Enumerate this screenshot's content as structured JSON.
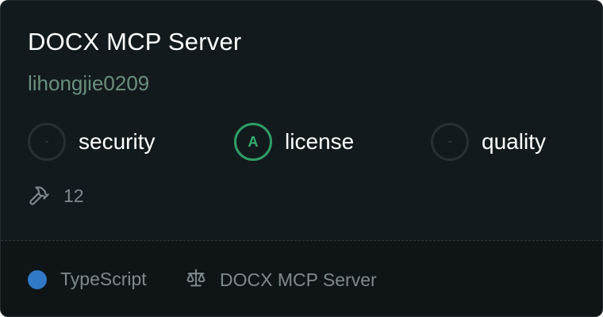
{
  "server": {
    "name": "DOCX MCP Server",
    "owner": "lihongjie0209"
  },
  "scores": [
    {
      "badge": "-",
      "label": "security"
    },
    {
      "badge": "A",
      "label": "license"
    },
    {
      "badge": "-",
      "label": "quality"
    }
  ],
  "tools": {
    "icon": "hammer-icon",
    "count": "12"
  },
  "footer": {
    "language": "TypeScript",
    "language_color": "#3178c6",
    "license_icon": "scale-icon",
    "license_text": "DOCX MCP Server"
  },
  "colors": {
    "card_bg": "#121a1d",
    "grade_a": "#2f9e66",
    "owner_text": "#6b8f7d"
  }
}
